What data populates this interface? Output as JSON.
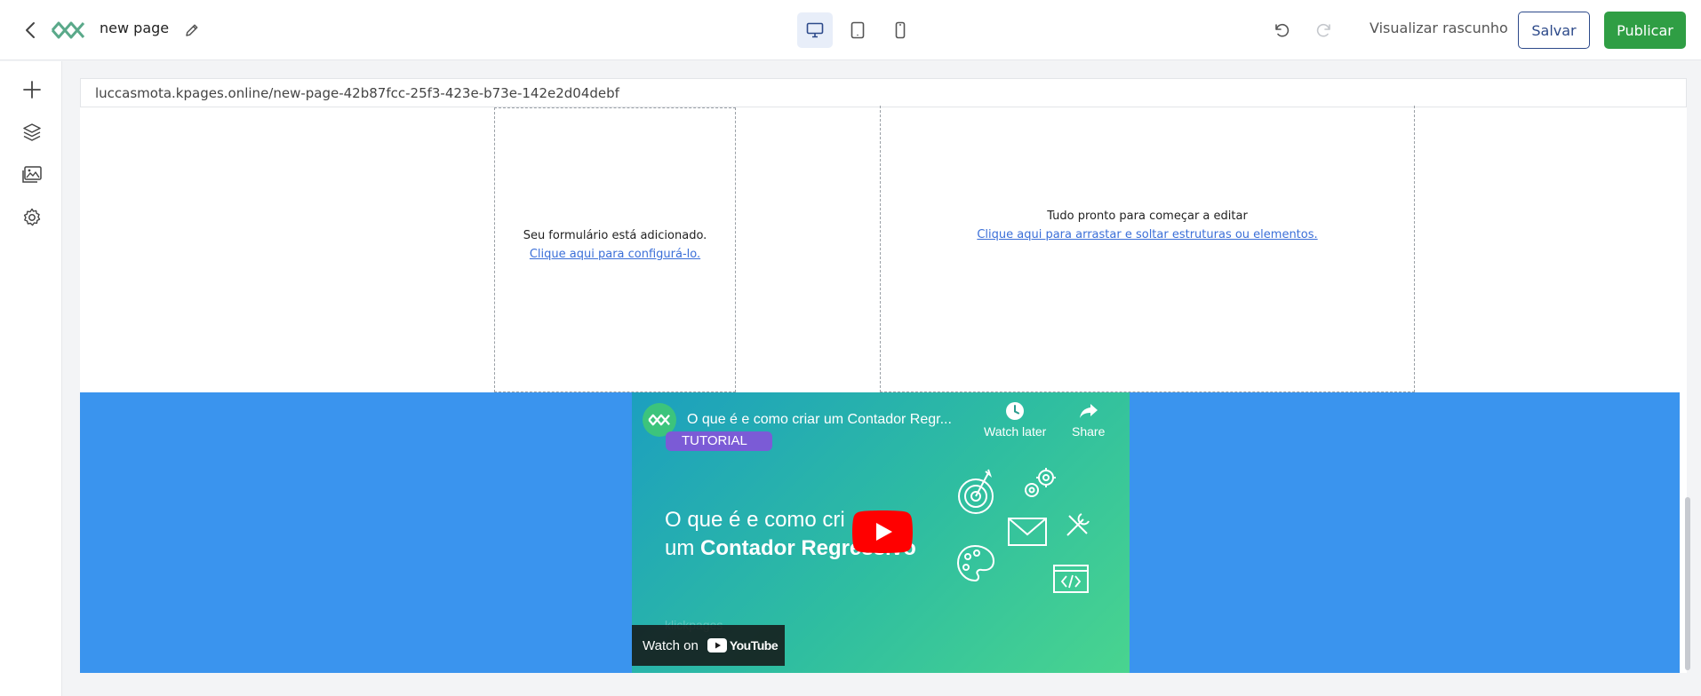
{
  "header": {
    "page_name": "new page",
    "preview_label": "Visualizar rascunho",
    "save_label": "Salvar",
    "publish_label": "Publicar"
  },
  "canvas": {
    "url": "luccasmota.kpages.online/new-page-42b87fcc-25f3-423e-b73e-142e2d04debf",
    "form_block": {
      "message": "Seu formulário está adicionado.",
      "link": "Clique aqui para configurá-lo."
    },
    "empty_block": {
      "message": "Tudo pronto para começar a editar",
      "link": "Clique aqui para arrastar e soltar estruturas ou elementos."
    }
  },
  "video": {
    "title": "O que é e como criar um Contador Regr...",
    "badge": "TUTORIAL",
    "watch_later": "Watch later",
    "share": "Share",
    "heading_line1": "O que é e como cri",
    "heading_line2_prefix": "um ",
    "heading_line2_bold": "Contador Regressivo",
    "watermark": "klickpages",
    "watch_on": "Watch on",
    "youtube": "YouTube"
  },
  "colors": {
    "accent": "#2f9e44",
    "save_border": "#2d4a8a",
    "section_blue": "#3a94ee",
    "link": "#3b6fd8"
  }
}
